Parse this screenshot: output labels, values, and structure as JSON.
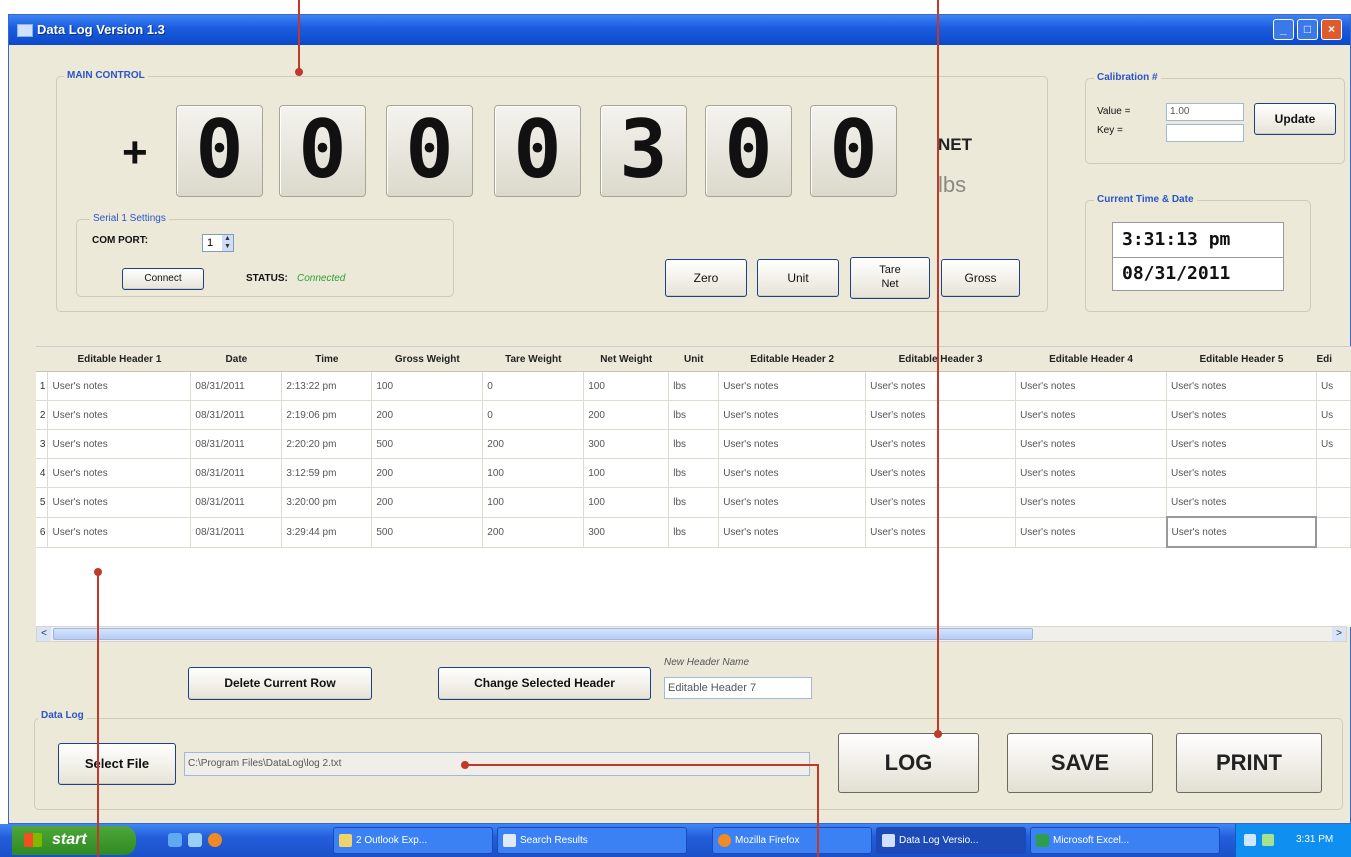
{
  "window": {
    "title": "Data Log Version 1.3"
  },
  "main_control": {
    "label": "MAIN CONTROL",
    "sign": "+",
    "digits": [
      "0",
      "0",
      "0",
      "0",
      "3",
      "0",
      "0"
    ],
    "mode": "NET",
    "unit": "lbs",
    "buttons": {
      "zero": "Zero",
      "unit": "Unit",
      "tare_net": "Tare Net",
      "gross": "Gross"
    }
  },
  "serial": {
    "label": "Serial 1 Settings",
    "com_port_label": "COM PORT:",
    "com_port_value": "1",
    "connect_label": "Connect",
    "status_label": "STATUS:",
    "status_value": "Connected"
  },
  "calibration": {
    "label": "Calibration #",
    "value_label": "Value =",
    "value": "1.00",
    "key_label": "Key =",
    "key": "",
    "update_label": "Update"
  },
  "clock": {
    "label": "Current Time & Date",
    "time": "3:31:13 pm",
    "date": "08/31/2011"
  },
  "table": {
    "headers": [
      "Editable Header 1",
      "Date",
      "Time",
      "Gross Weight",
      "Tare Weight",
      "Net Weight",
      "Unit",
      "Editable Header 2",
      "Editable Header 3",
      "Editable Header 4",
      "Editable Header 5",
      "Edi"
    ],
    "rows": [
      [
        "1",
        "User's notes",
        "08/31/2011",
        "2:13:22 pm",
        "100",
        "0",
        "100",
        "lbs",
        "User's notes",
        "User's notes",
        "User's notes",
        "User's notes",
        "Us"
      ],
      [
        "2",
        "User's notes",
        "08/31/2011",
        "2:19:06 pm",
        "200",
        "0",
        "200",
        "lbs",
        "User's notes",
        "User's notes",
        "User's notes",
        "User's notes",
        "Us"
      ],
      [
        "3",
        "User's notes",
        "08/31/2011",
        "2:20:20 pm",
        "500",
        "200",
        "300",
        "lbs",
        "User's notes",
        "User's notes",
        "User's notes",
        "User's notes",
        "Us"
      ],
      [
        "4",
        "User's notes",
        "08/31/2011",
        "3:12:59 pm",
        "200",
        "100",
        "100",
        "lbs",
        "User's notes",
        "User's notes",
        "User's notes",
        "User's notes",
        ""
      ],
      [
        "5",
        "User's notes",
        "08/31/2011",
        "3:20:00 pm",
        "200",
        "100",
        "100",
        "lbs",
        "User's notes",
        "User's notes",
        "User's notes",
        "User's notes",
        ""
      ],
      [
        "6",
        "User's notes",
        "08/31/2011",
        "3:29:44 pm",
        "500",
        "200",
        "300",
        "lbs",
        "User's notes",
        "User's notes",
        "User's notes",
        "User's notes",
        ""
      ]
    ]
  },
  "actions": {
    "delete_row": "Delete Current Row",
    "change_header": "Change Selected Header",
    "new_header_label": "New Header Name",
    "new_header_value": "Editable Header 7"
  },
  "data_log": {
    "label": "Data Log",
    "select_file": "Select File",
    "file_path": "C:\\Program Files\\DataLog\\log 2.txt",
    "log": "LOG",
    "save": "SAVE",
    "print": "PRINT"
  },
  "taskbar": {
    "start": "start",
    "tasks": [
      "2 Outlook Exp...",
      "Search Results",
      "Mozilla Firefox",
      "Data Log Versio...",
      "Microsoft Excel..."
    ],
    "clock": "3:31 PM"
  },
  "colors": {
    "accent": "#2a55c8",
    "callout": "#c0392b",
    "status_ok": "#2e9e3a"
  }
}
